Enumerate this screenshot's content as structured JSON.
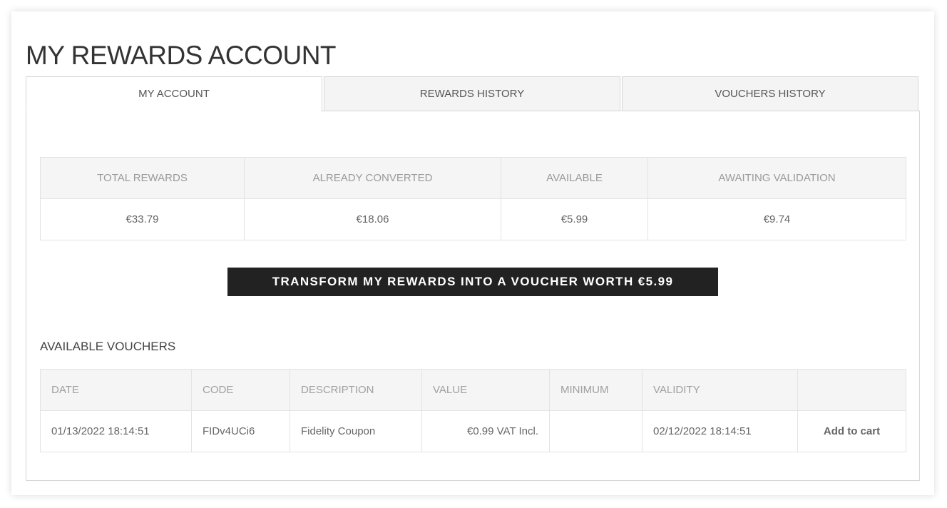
{
  "page": {
    "title": "MY REWARDS ACCOUNT"
  },
  "tabs": [
    {
      "label": "MY ACCOUNT",
      "active": true
    },
    {
      "label": "REWARDS HISTORY",
      "active": false
    },
    {
      "label": "VOUCHERS HISTORY",
      "active": false
    }
  ],
  "summary": {
    "headers": [
      "TOTAL REWARDS",
      "ALREADY CONVERTED",
      "AVAILABLE",
      "AWAITING VALIDATION"
    ],
    "values": [
      "€33.79",
      "€18.06",
      "€5.99",
      "€9.74"
    ]
  },
  "transform_button": {
    "label": "TRANSFORM MY REWARDS INTO A VOUCHER WORTH €5.99"
  },
  "vouchers": {
    "title": "AVAILABLE VOUCHERS",
    "headers": [
      "DATE",
      "CODE",
      "DESCRIPTION",
      "VALUE",
      "MINIMUM",
      "VALIDITY",
      ""
    ],
    "rows": [
      {
        "date": "01/13/2022 18:14:51",
        "code": "FIDv4UCi6",
        "description": "Fidelity Coupon",
        "value": "€0.99 VAT Incl.",
        "minimum": "",
        "validity": "02/12/2022 18:14:51",
        "action": "Add to cart"
      }
    ]
  },
  "colors": {
    "button_bg": "#222222",
    "header_bg": "#f5f5f5",
    "border": "#e3e3e3"
  }
}
